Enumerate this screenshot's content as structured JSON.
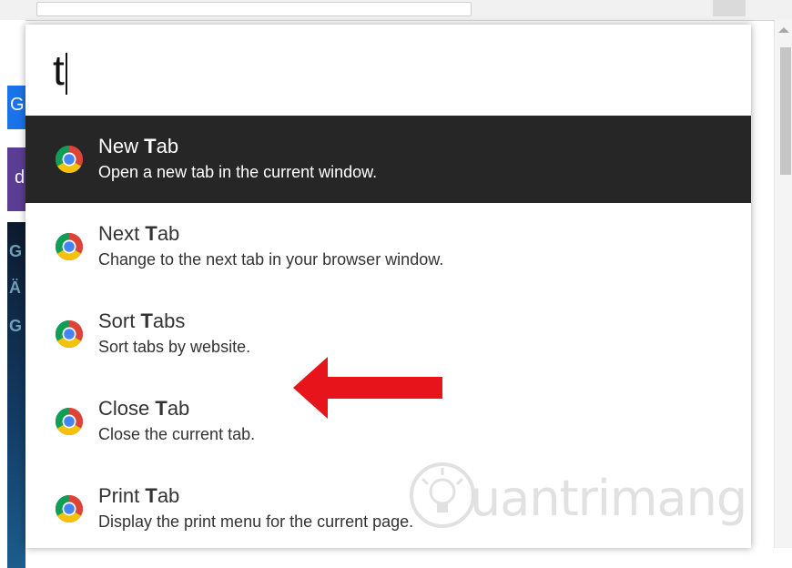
{
  "search": {
    "value": "t"
  },
  "results": [
    {
      "pre": "New ",
      "hl": "T",
      "post": "ab",
      "desc": "Open a new tab in the current window.",
      "selected": true
    },
    {
      "pre": "Next ",
      "hl": "T",
      "post": "ab",
      "desc": "Change to the next tab in your browser window."
    },
    {
      "pre": "Sort ",
      "hl": "T",
      "post": "abs",
      "desc": "Sort tabs by website."
    },
    {
      "pre": "Close ",
      "hl": "T",
      "post": "ab",
      "desc": "Close the current tab."
    },
    {
      "pre": "Print ",
      "hl": "T",
      "post": "ab",
      "desc": "Display the print menu for the current page."
    }
  ],
  "background": {
    "blue_letter": "G",
    "purple_letter": "d",
    "dark_letters": [
      "G",
      "Ä",
      "G"
    ]
  },
  "watermark": "uantrimang",
  "colors": {
    "selected_bg": "#262626",
    "arrow": "#e8141b",
    "chrome_red": "#db4437",
    "chrome_yellow": "#f4c20d",
    "chrome_green": "#0f9d58",
    "chrome_blue": "#4285f4"
  }
}
